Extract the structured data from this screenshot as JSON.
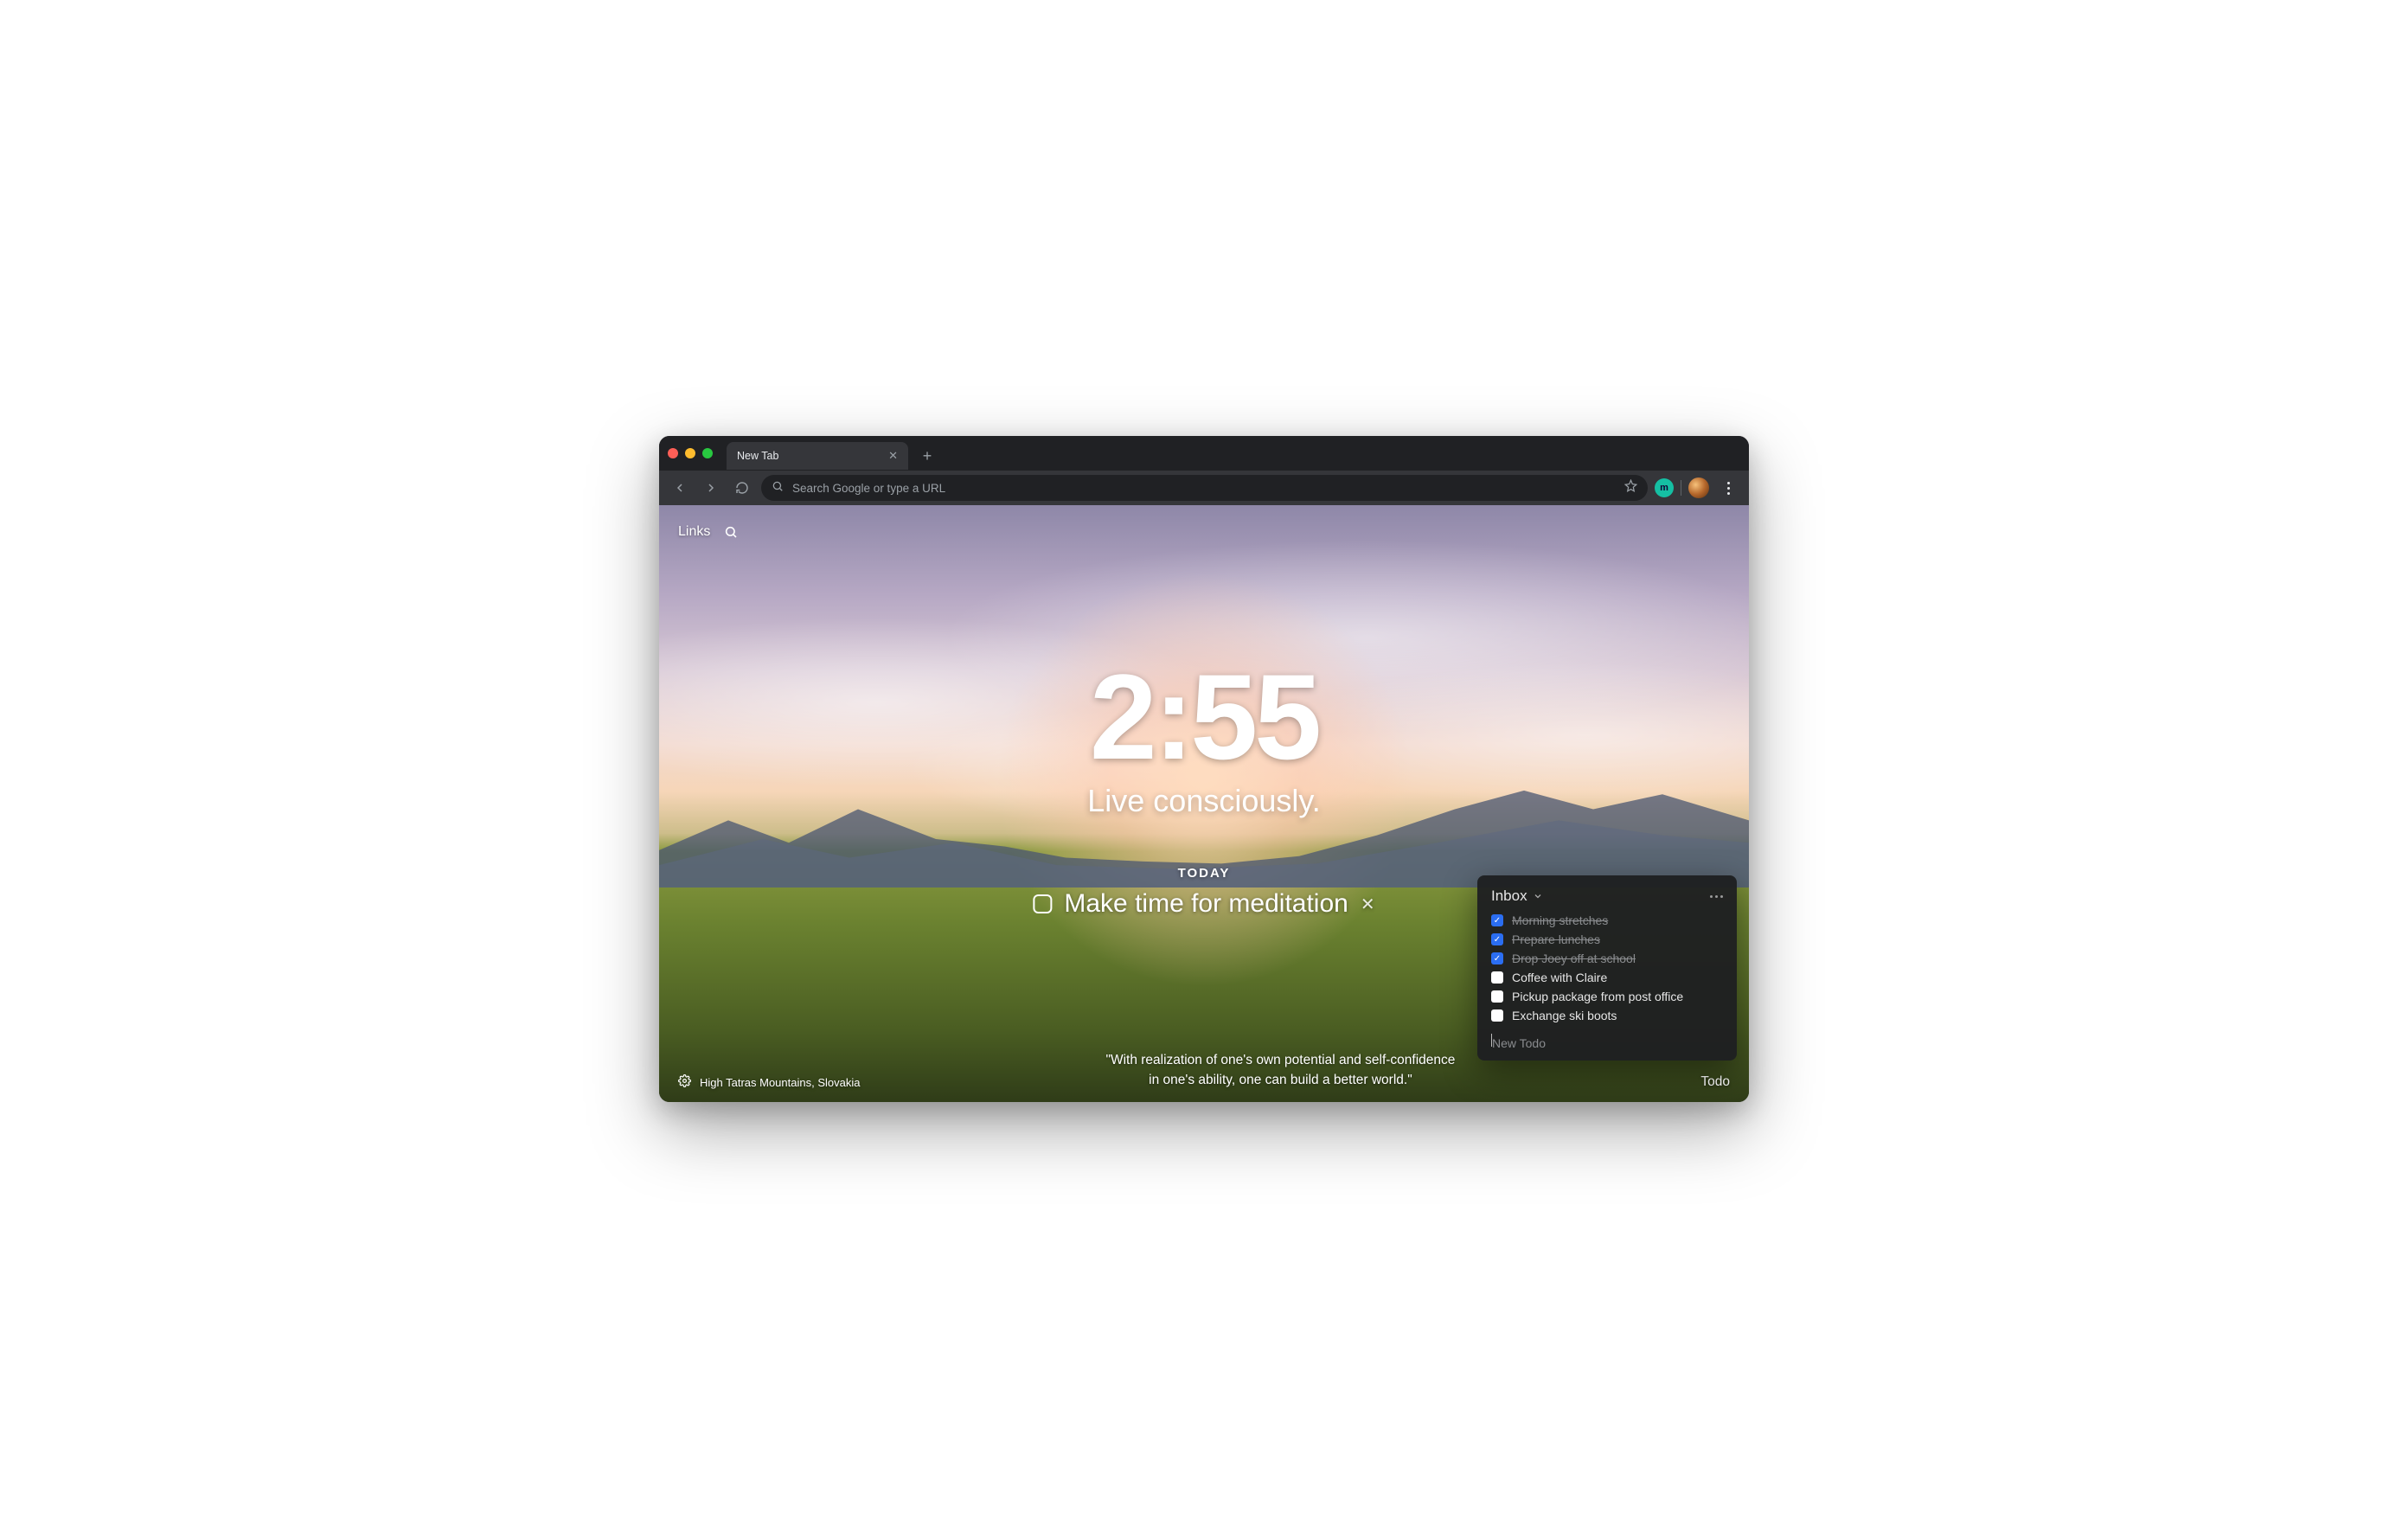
{
  "tab": {
    "title": "New Tab"
  },
  "omnibox": {
    "placeholder": "Search Google or type a URL"
  },
  "profile_initial": "m",
  "nav": {
    "links_label": "Links"
  },
  "clock": "2:55",
  "mantra": "Live consciously.",
  "focus": {
    "label": "TODAY",
    "text": "Make time for meditation"
  },
  "quote": {
    "line1": "\"With realization of one's own potential and self-confidence",
    "line2": "in one's ability, one can build a better world.\""
  },
  "location": "High Tatras Mountains, Slovakia",
  "todo_toggle_label": "Todo",
  "todo": {
    "title": "Inbox",
    "items": [
      {
        "label": "Morning stretches",
        "done": true
      },
      {
        "label": "Prepare lunches",
        "done": true
      },
      {
        "label": "Drop Joey off at school",
        "done": true
      },
      {
        "label": "Coffee with Claire",
        "done": false
      },
      {
        "label": "Pickup package from post office",
        "done": false
      },
      {
        "label": "Exchange ski boots",
        "done": false
      }
    ],
    "new_placeholder": "New Todo"
  }
}
